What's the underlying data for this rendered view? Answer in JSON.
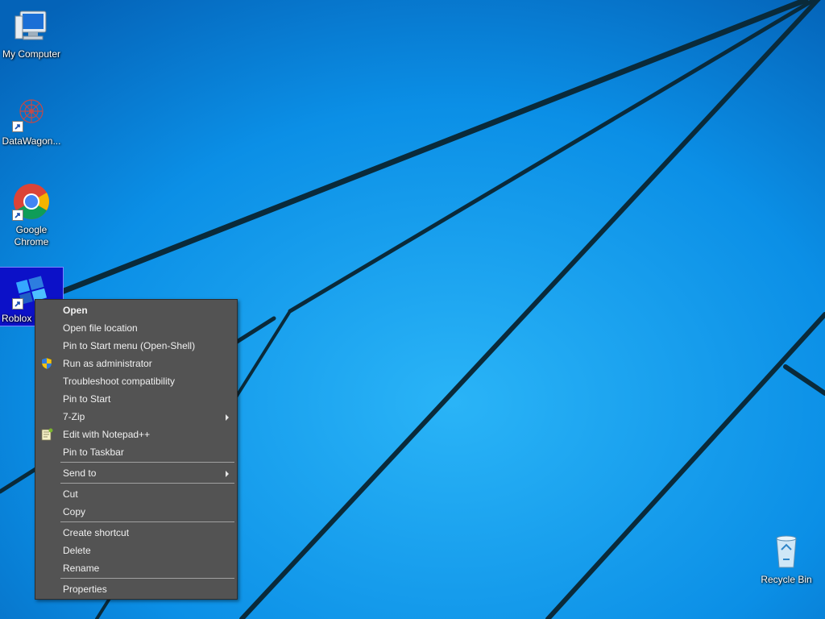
{
  "desktop": {
    "icons": [
      {
        "label": "My Computer"
      },
      {
        "label": "DataWagon..."
      },
      {
        "label": "Google\nChrome"
      },
      {
        "label": "Roblox S"
      },
      {
        "label": "Recycle Bin"
      }
    ]
  },
  "context_menu": {
    "items": [
      {
        "label": "Open"
      },
      {
        "label": "Open file location"
      },
      {
        "label": "Pin to Start menu (Open-Shell)"
      },
      {
        "label": "Run as administrator"
      },
      {
        "label": "Troubleshoot compatibility"
      },
      {
        "label": "Pin to Start"
      },
      {
        "label": "7-Zip"
      },
      {
        "label": "Edit with Notepad++"
      },
      {
        "label": "Pin to Taskbar"
      },
      {
        "label": "Send to"
      },
      {
        "label": "Cut"
      },
      {
        "label": "Copy"
      },
      {
        "label": "Create shortcut"
      },
      {
        "label": "Delete"
      },
      {
        "label": "Rename"
      },
      {
        "label": "Properties"
      }
    ]
  },
  "colors": {
    "wallpaper": "#0a7ad8",
    "menu_background": "#535353",
    "selection": "#0c11c8"
  },
  "icon_names": {
    "uac_shield": "uac-shield-icon",
    "notepad": "notepad-plus-plus-icon",
    "shortcut_overlay": "shortcut-arrow-icon"
  }
}
